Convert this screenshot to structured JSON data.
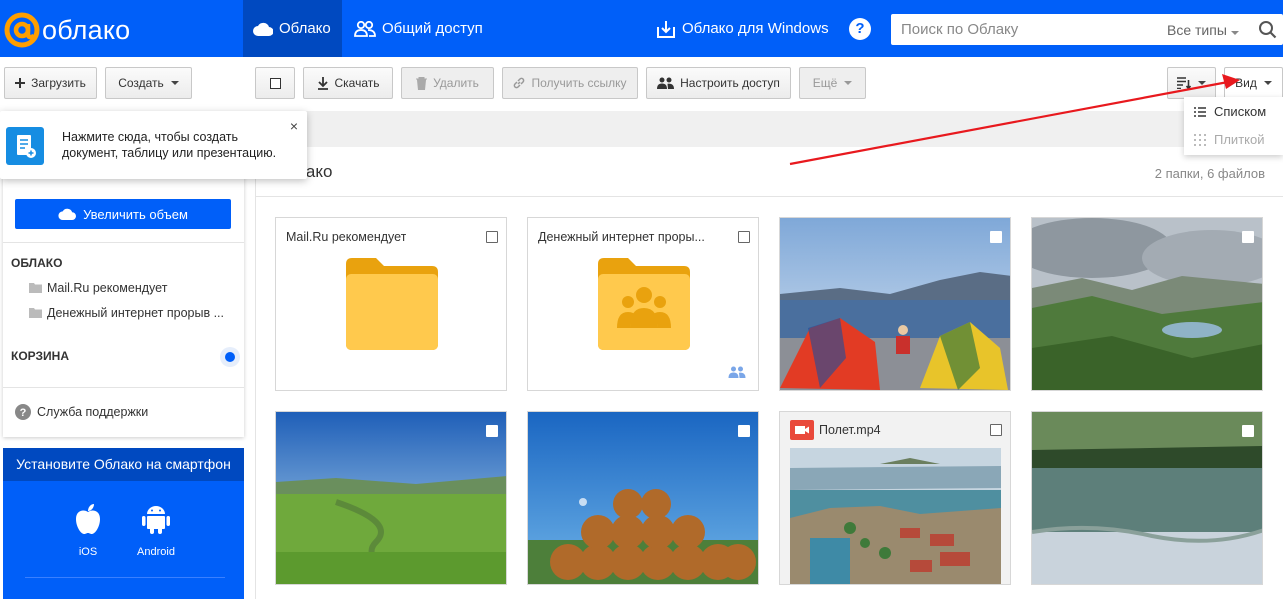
{
  "header": {
    "logo_text": "облако",
    "tabs": [
      {
        "label": "Облако"
      },
      {
        "label": "Общий доступ"
      }
    ],
    "windows_link": "Облако для Windows",
    "help": "?",
    "search": {
      "placeholder": "Поиск по Облаку",
      "types": "Все типы"
    }
  },
  "toolbar": {
    "upload": "Загрузить",
    "create": "Создать",
    "download": "Скачать",
    "delete": "Удалить",
    "get_link": "Получить ссылку",
    "setup_access": "Настроить доступ",
    "more": "Ещё",
    "view": "Вид"
  },
  "view_menu": {
    "list": "Списком",
    "tiles": "Плиткой"
  },
  "tooltip": {
    "text": "Нажмите сюда, чтобы создать документ, таблицу или презентацию.",
    "close": "×"
  },
  "sidebar": {
    "increase_button": "Увеличить объем",
    "cloud_heading": "ОБЛАКО",
    "folders": [
      {
        "label": "Mail.Ru рекомендует"
      },
      {
        "label": "Денежный интернет прорыв ..."
      }
    ],
    "trash_heading": "КОРЗИНА",
    "support": "Служба поддержки"
  },
  "promo": {
    "title": "Установите Облако на смартфон",
    "ios": "iOS",
    "android": "Android"
  },
  "main": {
    "title_partial": "лако",
    "count": "2 папки, 6 файлов",
    "tiles": [
      {
        "name": "Mail.Ru рекомендует",
        "kind": "folder"
      },
      {
        "name": "Денежный интернет проры...",
        "kind": "shared-folder"
      },
      {
        "kind": "photo-tents"
      },
      {
        "kind": "photo-mountains"
      },
      {
        "kind": "photo-meadow"
      },
      {
        "kind": "photo-haybales"
      },
      {
        "name": "Полет.mp4",
        "kind": "video"
      },
      {
        "kind": "photo-lake"
      }
    ]
  },
  "colors": {
    "brand_blue": "#005ff9",
    "active_tab": "#0049c0",
    "folder_yellow": "#ffc94d",
    "arrow_red": "#e8191e"
  }
}
